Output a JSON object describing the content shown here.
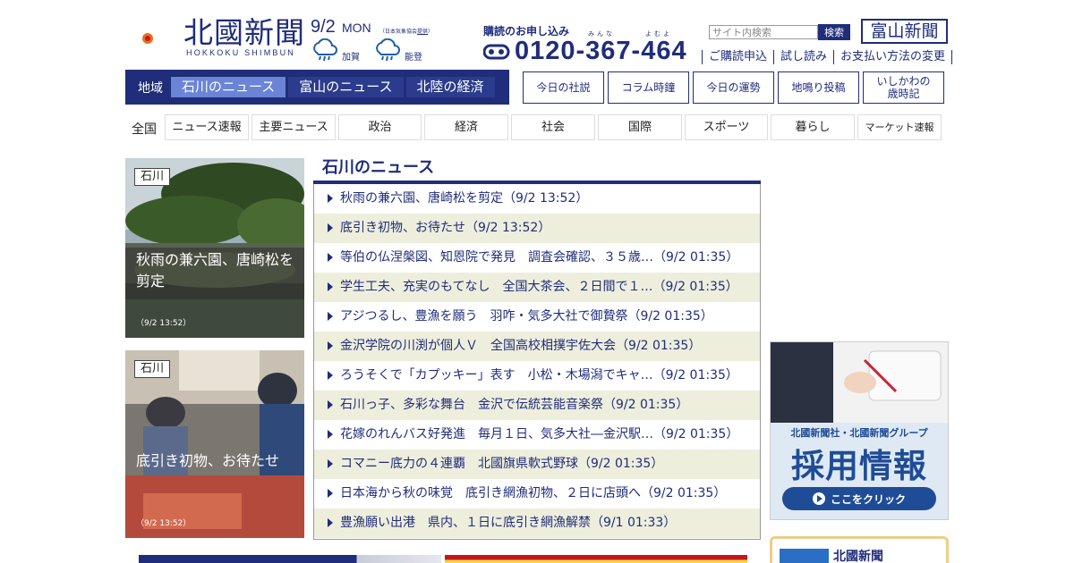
{
  "header": {
    "logo_name": "北國新聞",
    "logo_sub": "HOKKOKU SHIMBUN",
    "date": "9/2",
    "weekday": "MON",
    "weather_source_prefix": "（日本気象協会",
    "weather_source_link": "提供",
    "weather_source_suffix": "）",
    "weather": [
      {
        "area": "加賀",
        "icon": "rain-icon"
      },
      {
        "area": "能登",
        "icon": "rain-icon"
      }
    ],
    "subscribe_title": "購読のお申し込み",
    "ruby_1": "みんな",
    "ruby_2": "よむよ",
    "phone": "0120-367-464",
    "search_placeholder": "サイト内検索",
    "search_button": "検索",
    "toyama_logo": "富山新聞",
    "sub_links": [
      "ご購読申込",
      "試し読み",
      "お支払い方法の変更"
    ]
  },
  "region_nav": {
    "label": "地域",
    "tabs": [
      "石川のニュース",
      "富山のニュース",
      "北陸の経済"
    ],
    "active": 0
  },
  "feature_buttons": [
    "今日の社説",
    "コラム時鐘",
    "今日の運勢",
    "地鳴り投稿",
    "いしかわの\n歳時記"
  ],
  "categories": {
    "all": "全国",
    "items": [
      "ニュース速報",
      "主要ニュース",
      "政治",
      "経済",
      "社会",
      "国際",
      "スポーツ",
      "暮らし",
      "マーケット速報"
    ]
  },
  "photos": [
    {
      "tag": "石川",
      "caption": "秋雨の兼六園、唐崎松を剪定",
      "time": "（9/2 13:52）"
    },
    {
      "tag": "石川",
      "caption": "底引き初物、お待たせ",
      "time": "（9/2 13:52）"
    }
  ],
  "news": {
    "title": "石川のニュース",
    "items": [
      "秋雨の兼六園、唐崎松を剪定（9/2 13:52）",
      "底引き初物、お待たせ（9/2 13:52）",
      "等伯の仏涅槃図、知恩院で発見　調査会確認、３５歳…（9/2 01:35）",
      "学生工夫、充実のもてなし　全国大茶会、２日間で１…（9/2 01:35）",
      "アジつるし、豊漁を願う　羽咋・気多大社で御贄祭（9/2 01:35）",
      "金沢学院の川渕が個人Ｖ　全国高校相撲宇佐大会（9/2 01:35）",
      "ろうそくで「カプッキー」表す　小松・木場潟でキャ…（9/2 01:35）",
      "石川っ子、多彩な舞台　金沢で伝統芸能音楽祭（9/2 01:35）",
      "花嫁のれんバス好発進　毎月１日、気多大社―金沢駅…（9/2 01:35）",
      "コマニー底力の４連覇　北國旗県軟式野球（9/2 01:35）",
      "日本海から秋の味覚　底引き網漁初物、２日に店頭へ（9/2 01:35）",
      "豊漁願い出港　県内、１日に底引き網漁解禁（9/1 01:33）"
    ]
  },
  "ads": {
    "recruit_line1": "北國新聞社・北國新聞グループ",
    "recruit_line2": "採用情報",
    "recruit_button": "ここをクリック",
    "hokkoku_box": "北國新聞"
  },
  "colors": {
    "brand_navy": "#1f2d7a",
    "active_tab": "#6a84d6",
    "alt_row": "#eeeedd",
    "logo_orange": "#e8711a"
  }
}
